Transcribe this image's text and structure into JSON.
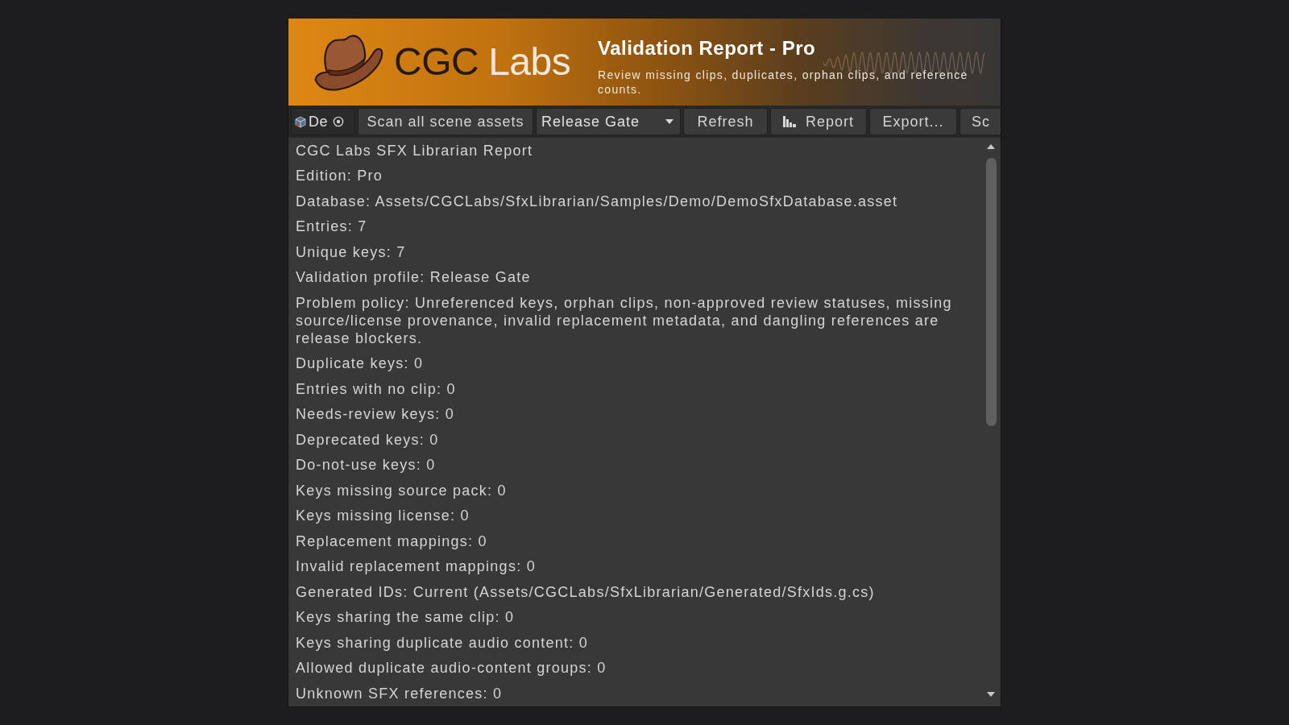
{
  "header": {
    "logo": {
      "parts": [
        "CGC",
        "Labs"
      ]
    },
    "title": "Validation Report - Pro",
    "subtitle": "Review missing clips, duplicates, orphan clips, and reference counts."
  },
  "toolbar": {
    "items": [
      {
        "kind": "object_field",
        "label": "De"
      },
      {
        "kind": "button",
        "label": "Scan all scene assets"
      },
      {
        "kind": "dropdown",
        "label": "Release Gate"
      },
      {
        "kind": "button",
        "label": "Refresh"
      },
      {
        "kind": "icon_button",
        "label": "Report"
      },
      {
        "kind": "button",
        "label": "Export..."
      },
      {
        "kind": "button",
        "label": "Sc"
      }
    ]
  },
  "report": {
    "lines": [
      "CGC Labs SFX Librarian Report",
      "Edition: Pro",
      "Database: Assets/CGCLabs/SfxLibrarian/Samples/Demo/DemoSfxDatabase.asset",
      "Entries: 7",
      "Unique keys: 7",
      "Validation profile: Release Gate",
      "Problem policy: Unreferenced keys, orphan clips, non-approved review statuses, missing source/license provenance, invalid replacement metadata, and dangling references are release blockers.",
      "Duplicate keys: 0",
      "Entries with no clip: 0",
      "Needs-review keys: 0",
      "Deprecated keys: 0",
      "Do-not-use keys: 0",
      "Keys missing source pack: 0",
      "Keys missing license: 0",
      "Replacement mappings: 0",
      "Invalid replacement mappings: 0",
      "Generated IDs: Current (Assets/CGCLabs/SfxLibrarian/Generated/SfxIds.g.cs)",
      "Keys sharing the same clip: 0",
      "Keys sharing duplicate audio content: 0",
      "Allowed duplicate audio-content groups: 0",
      "Unknown SFX references: 0"
    ]
  }
}
